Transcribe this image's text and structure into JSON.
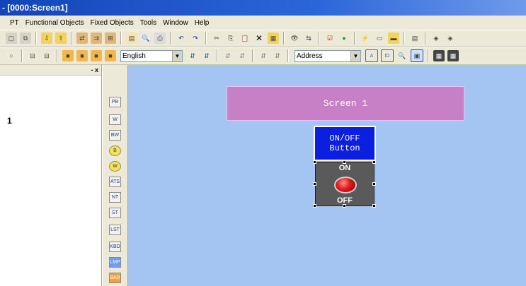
{
  "window": {
    "title": "- [0000:Screen1]"
  },
  "menu": {
    "items": [
      "PT",
      "Functional Objects",
      "Fixed Objects",
      "Tools",
      "Window",
      "Help"
    ]
  },
  "toolbar2": {
    "language_combo": "English",
    "address_combo": "Address"
  },
  "left_panel": {
    "controls": "- x",
    "item_label": "1"
  },
  "object_toolbar": {
    "buttons": [
      "PB",
      "W",
      "BW",
      "B",
      "W",
      "ATS",
      "NT",
      "ST",
      "LST",
      "KBD",
      "LMP",
      "BAR"
    ]
  },
  "canvas": {
    "screen_label": "Screen 1",
    "onoff_button": {
      "line1": "ON/OFF",
      "line2": "Button"
    },
    "toggle": {
      "on_label": "ON",
      "off_label": "OFF"
    }
  },
  "colors": {
    "canvas_bg": "#a4c5f1",
    "screen_label_bg": "#c77fc6",
    "button_bg": "#0a1fe0",
    "title_bar": "#1246b8"
  }
}
